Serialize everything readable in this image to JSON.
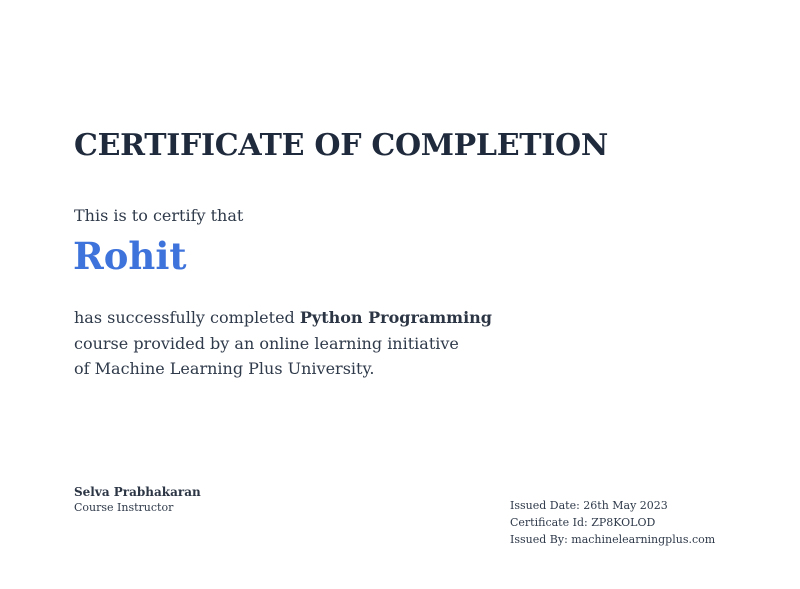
{
  "certificate": {
    "title": "CERTIFICATE OF COMPLETION",
    "intro": "This is to certify that",
    "recipient": "Rohit",
    "body": {
      "completed_prefix": "has successfully completed",
      "course_name": "Python Programming",
      "line2": "course provided by an online learning initiative",
      "line3": "of Machine Learning Plus University."
    },
    "instructor": {
      "name": "Selva Prabhakaran",
      "role": "Course Instructor"
    },
    "meta": {
      "issued_date": "Issued Date: 26th May 2023",
      "certificate_id": "Certificate Id: ZP8KOLOD",
      "issued_by": "Issued By: machinelearningplus.com"
    }
  },
  "colors": {
    "title": "#1f2a3c",
    "recipient": "#3f73dc",
    "text": "#2f3a4a"
  }
}
